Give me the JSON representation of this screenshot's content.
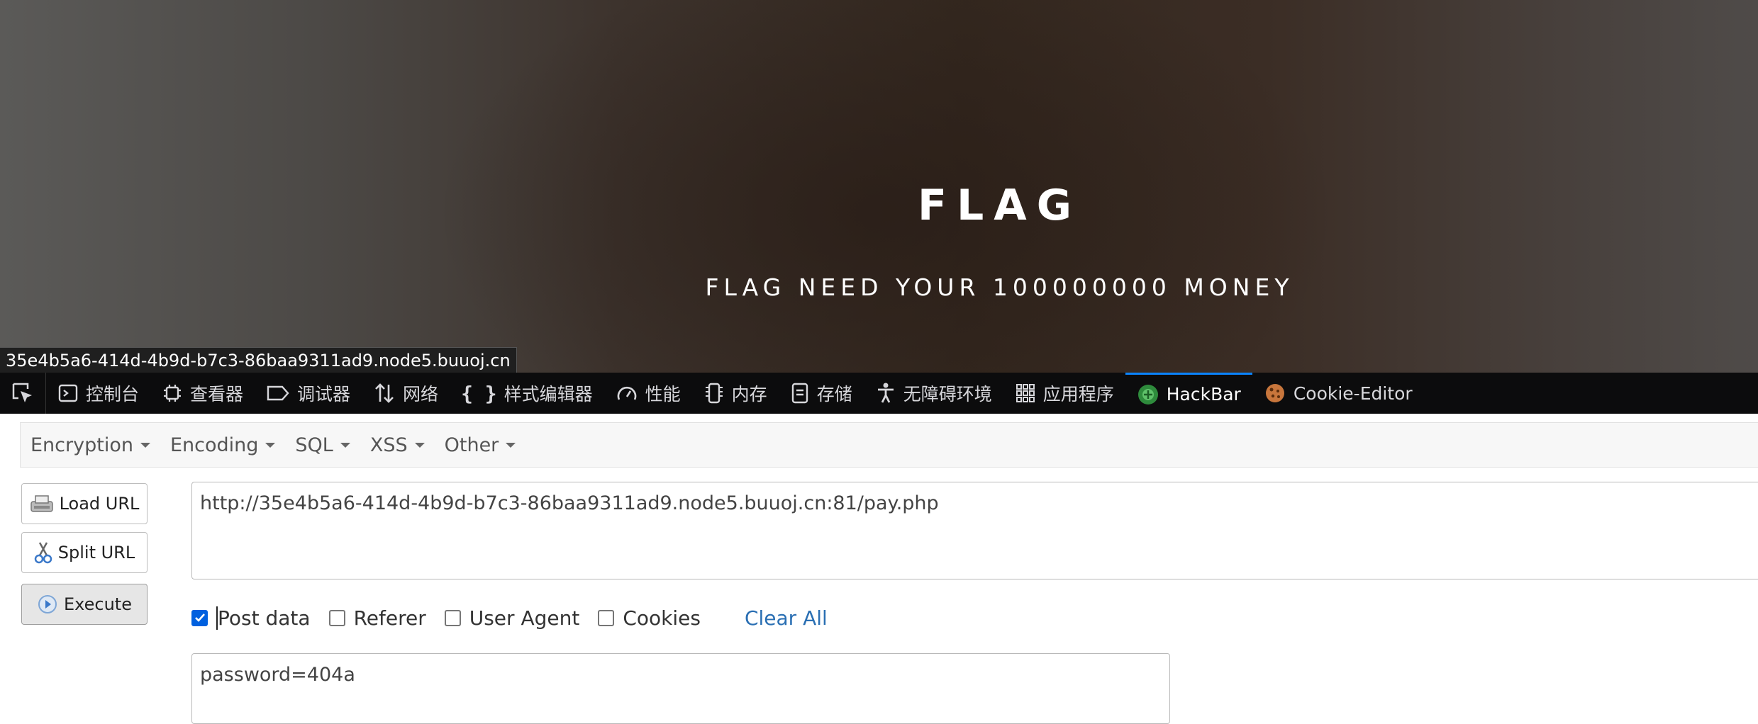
{
  "page": {
    "title": "FLAG",
    "subtitle": "FLAG NEED YOUR 100000000 MONEY",
    "status_url": "35e4b5a6-414d-4b9d-b7c3-86baa9311ad9.node5.buuoj.cn"
  },
  "devtools": {
    "tabs": [
      {
        "label": "控制台",
        "icon": "console-icon"
      },
      {
        "label": "查看器",
        "icon": "inspector-icon"
      },
      {
        "label": "调试器",
        "icon": "debugger-icon"
      },
      {
        "label": "网络",
        "icon": "network-icon"
      },
      {
        "label": "样式编辑器",
        "icon": "style-editor-icon"
      },
      {
        "label": "性能",
        "icon": "performance-icon"
      },
      {
        "label": "内存",
        "icon": "memory-icon"
      },
      {
        "label": "存储",
        "icon": "storage-icon"
      },
      {
        "label": "无障碍环境",
        "icon": "accessibility-icon"
      },
      {
        "label": "应用程序",
        "icon": "application-icon"
      },
      {
        "label": "HackBar",
        "icon": "hackbar-icon",
        "active": true
      },
      {
        "label": "Cookie-Editor",
        "icon": "cookie-icon"
      }
    ],
    "active_color": "#0a84ff"
  },
  "hackbar": {
    "menus": [
      "Encryption",
      "Encoding",
      "SQL",
      "XSS",
      "Other"
    ],
    "buttons": {
      "load": "Load URL",
      "split": "Split URL",
      "execute": "Execute"
    },
    "url": "http://35e4b5a6-414d-4b9d-b7c3-86baa9311ad9.node5.buuoj.cn:81/pay.php",
    "options": {
      "post_data": {
        "label": "Post data",
        "checked": true
      },
      "referer": {
        "label": "Referer",
        "checked": false
      },
      "user_agent": {
        "label": "User Agent",
        "checked": false
      },
      "cookies": {
        "label": "Cookies",
        "checked": false
      }
    },
    "clear_all": "Clear All",
    "post_body": "password=404a"
  }
}
